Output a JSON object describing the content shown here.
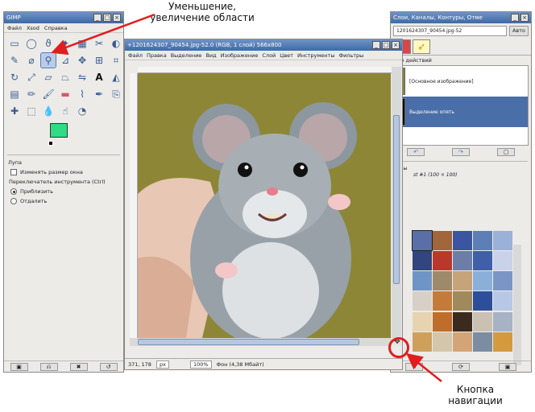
{
  "annotations": {
    "top": "Уменьшение, увеличение области",
    "bottom": "Кнопка навигации",
    "arrow_color": "#e11d1d"
  },
  "toolbox": {
    "title": "GIMP",
    "menu": [
      "Файл",
      "Xsod",
      "Справка"
    ],
    "fg_color": "#2fdc84",
    "options_title": "Лупа",
    "resize_label": "Изменять размер окна",
    "switch_label": "Переключатель инструмента (Ctrl)",
    "zoom_in": "Приблизить",
    "zoom_out": "Отдалить",
    "icons": [
      "rect-select",
      "ellipse-select",
      "lasso",
      "fuzzy-select",
      "color-select",
      "scissors",
      "foreground-select",
      "paths",
      "color-picker",
      "zoom",
      "measure",
      "move",
      "align",
      "crop",
      "rotate",
      "scale",
      "shear",
      "perspective",
      "flip",
      "text",
      "bucket-fill",
      "gradient",
      "pencil",
      "paintbrush",
      "eraser",
      "airbrush",
      "ink",
      "clone",
      "heal",
      "perspective-clone",
      "blur",
      "smudge",
      "dodge-burn",
      "",
      ""
    ]
  },
  "image_window": {
    "title": "+1201624307_90454.jpg-52.0 (RGB, 1 слой) 566x800",
    "menu": [
      "Файл",
      "Правка",
      "Выделение",
      "Вид",
      "Изображение",
      "Слой",
      "Цвет",
      "Инструменты",
      "Фильтры"
    ],
    "coords": "371, 178",
    "unit": "px",
    "zoom": "100%",
    "status": "Фон (4,38 Мбайт)"
  },
  "dock": {
    "title": "Слои, Каналы, Контуры, Отме",
    "image_select": "1201624307_90454.jpg-52",
    "auto_button": "Авто",
    "history_title": "ние действий",
    "history_items": [
      "[Основное изображение]",
      "Выделение опять"
    ],
    "patterns_title": "зуры",
    "patterns_subtitle": "st #1 (100 × 100)",
    "pattern_colors": [
      "#5a6fa8",
      "#a1663a",
      "#3b56a0",
      "#5e7fb5",
      "#9bb1d8",
      "#33457f",
      "#b8392b",
      "#6c7da8",
      "#3f5fa8",
      "#c9d2e8",
      "#6f95c6",
      "#9d8a6b",
      "#c6a47a",
      "#8ab0da",
      "#7b96c4",
      "#d7d0c6",
      "#c47b3a",
      "#a08a5c",
      "#2d4f9a",
      "#b7c7e6",
      "#e6d3b0",
      "#bf6d2a",
      "#3a2b1e",
      "#c9c2b2",
      "#a7b2c4",
      "#cfa05c",
      "#d3c6aa",
      "#d2a476",
      "#7c8da3",
      "#d49a3d"
    ]
  }
}
